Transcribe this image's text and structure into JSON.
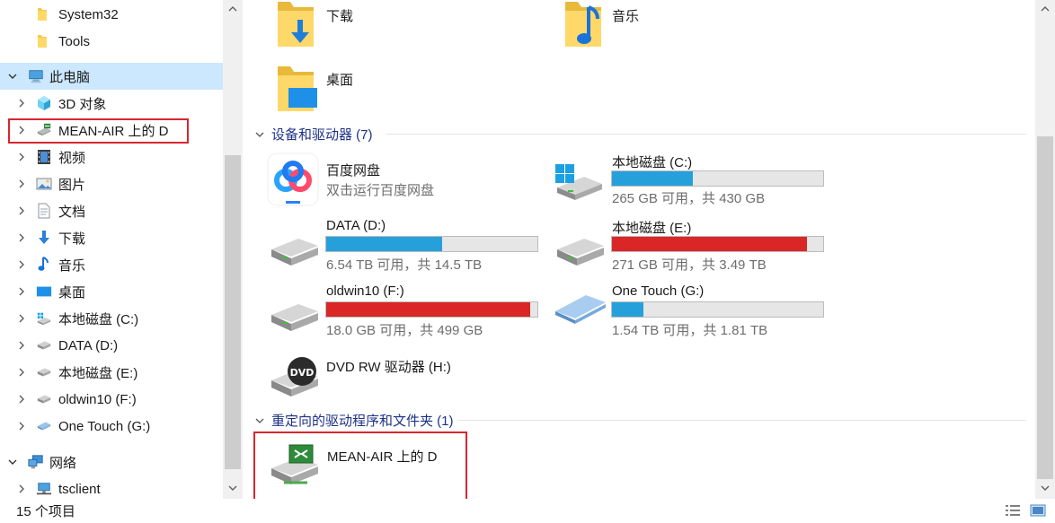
{
  "nav": {
    "items": [
      {
        "label": "System32",
        "icon": "folder-icon",
        "level": 2,
        "expandable": false
      },
      {
        "label": "Tools",
        "icon": "folder-icon",
        "level": 2,
        "expandable": false
      },
      {
        "label": "此电脑",
        "icon": "this-pc-icon",
        "level": 0,
        "expanded": true,
        "selected": true
      },
      {
        "label": "3D 对象",
        "icon": "3d-objects-icon",
        "level": 1
      },
      {
        "label": "MEAN-AIR 上的 D",
        "icon": "redirected-drive-icon",
        "level": 1,
        "highlighted": true
      },
      {
        "label": "视频",
        "icon": "video-icon",
        "level": 1
      },
      {
        "label": "图片",
        "icon": "pictures-icon",
        "level": 1
      },
      {
        "label": "文档",
        "icon": "documents-icon",
        "level": 1
      },
      {
        "label": "下载",
        "icon": "download-icon",
        "level": 1
      },
      {
        "label": "音乐",
        "icon": "music-icon",
        "level": 1
      },
      {
        "label": "桌面",
        "icon": "desktop-icon",
        "level": 1
      },
      {
        "label": "本地磁盘 (C:)",
        "icon": "system-drive-icon",
        "level": 1
      },
      {
        "label": "DATA (D:)",
        "icon": "drive-icon",
        "level": 1
      },
      {
        "label": "本地磁盘 (E:)",
        "icon": "drive-icon",
        "level": 1
      },
      {
        "label": "oldwin10 (F:)",
        "icon": "drive-icon",
        "level": 1
      },
      {
        "label": "One Touch (G:)",
        "icon": "external-drive-icon",
        "level": 1
      },
      {
        "label": "网络",
        "icon": "network-icon",
        "level": 0,
        "expanded": true
      },
      {
        "label": "tsclient",
        "icon": "network-computer-icon",
        "level": 1
      }
    ]
  },
  "main": {
    "folders": [
      {
        "label": "下载",
        "icon": "download-folder-icon"
      },
      {
        "label": "音乐",
        "icon": "music-folder-icon"
      },
      {
        "label": "桌面",
        "icon": "desktop-folder-icon"
      }
    ],
    "devices_group": {
      "label": "设备和驱动器 (7)"
    },
    "devices": [
      {
        "name": "百度网盘",
        "sub": "双击运行百度网盘",
        "icon": "baidu-netdisk-icon"
      },
      {
        "name": "本地磁盘 (C:)",
        "sub": "265 GB 可用，共 430 GB",
        "icon": "windows-drive-icon",
        "usage": 0.384,
        "bar_color": "#26a0da"
      },
      {
        "name": "DATA (D:)",
        "sub": "6.54 TB 可用，共 14.5 TB",
        "icon": "hard-drive-icon",
        "usage": 0.549,
        "bar_color": "#26a0da"
      },
      {
        "name": "本地磁盘 (E:)",
        "sub": "271 GB 可用，共 3.49 TB",
        "icon": "hard-drive-icon",
        "usage": 0.924,
        "bar_color": "#da2626"
      },
      {
        "name": "oldwin10 (F:)",
        "sub": "18.0 GB 可用，共 499 GB",
        "icon": "hard-drive-icon",
        "usage": 0.964,
        "bar_color": "#da2626"
      },
      {
        "name": "One Touch (G:)",
        "sub": "1.54 TB 可用，共 1.81 TB",
        "icon": "external-drive-icon",
        "usage": 0.149,
        "bar_color": "#26a0da"
      },
      {
        "name": "DVD RW 驱动器 (H:)",
        "sub": "",
        "icon": "dvd-drive-icon"
      }
    ],
    "redirected_group": {
      "label": "重定向的驱动程序和文件夹 (1)"
    },
    "redirected": [
      {
        "name": "MEAN-AIR 上的 D",
        "icon": "redirected-drive-icon",
        "highlighted": true
      }
    ]
  },
  "status": {
    "count": "15 个项目"
  },
  "colors": {
    "selection": "#cce8ff",
    "highlight_box": "#d9262f",
    "bar_normal": "#26a0da",
    "bar_full": "#da2626",
    "group_header": "#1e3287"
  }
}
